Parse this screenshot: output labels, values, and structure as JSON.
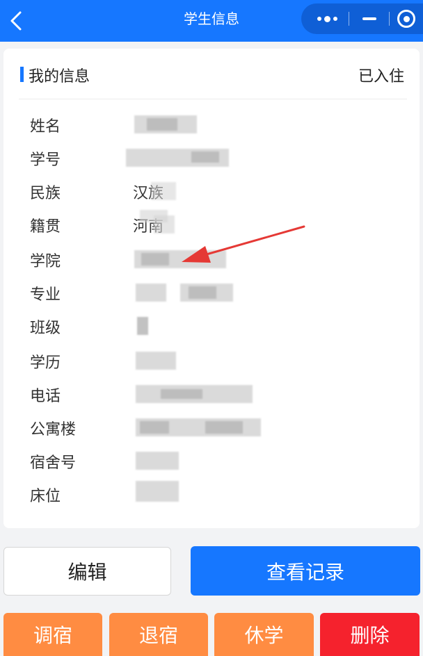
{
  "navbar": {
    "title": "学生信息",
    "back_icon": "chevron-left-icon",
    "more_icon": "more-dots-icon",
    "minimize_icon": "minus-icon",
    "close_icon": "target-circle-icon",
    "color": "#1677ff"
  },
  "card": {
    "title": "我的信息",
    "status": "已入住",
    "rows": [
      {
        "label": "姓名",
        "value": ""
      },
      {
        "label": "学号",
        "value": ""
      },
      {
        "label": "民族",
        "value": "汉族"
      },
      {
        "label": "籍贯",
        "value": "河南"
      },
      {
        "label": "学院",
        "value": ""
      },
      {
        "label": "专业",
        "value": ""
      },
      {
        "label": "班级",
        "value": ""
      },
      {
        "label": "学历",
        "value": ""
      },
      {
        "label": "电话",
        "value": ""
      },
      {
        "label": "公寓楼",
        "value": ""
      },
      {
        "label": "宿舍号",
        "value": ""
      },
      {
        "label": "床位",
        "value": ""
      }
    ]
  },
  "actions": {
    "edit": "编辑",
    "view_records": "查看记录",
    "change_room": "调宿",
    "check_out": "退宿",
    "suspend": "休学",
    "delete": "删除"
  },
  "colors": {
    "primary": "#1677ff",
    "orange": "#ff8c42",
    "danger": "#f5222d",
    "annotation_arrow": "#e53935"
  }
}
